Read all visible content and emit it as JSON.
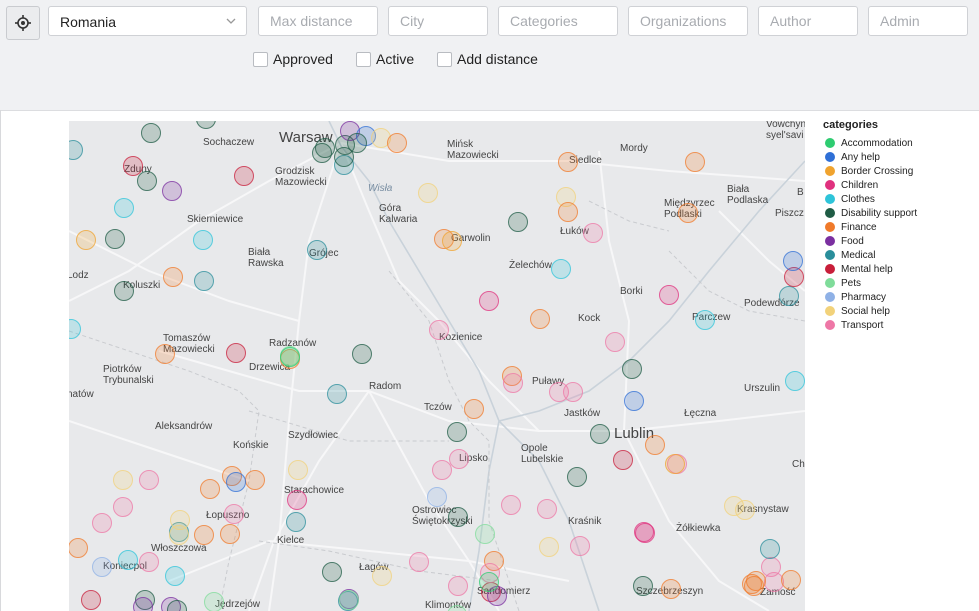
{
  "toolbar": {
    "locate_icon": "crosshair-icon",
    "country": "Romania",
    "max_distance_placeholder": "Max distance",
    "city_placeholder": "City",
    "categories_placeholder": "Categories",
    "organizations_placeholder": "Organizations",
    "author_placeholder": "Author",
    "admin_placeholder": "Admin",
    "checkboxes": [
      {
        "label": "Approved",
        "checked": false
      },
      {
        "label": "Active",
        "checked": false
      },
      {
        "label": "Add distance",
        "checked": false
      }
    ]
  },
  "legend": {
    "title": "categories",
    "items": [
      {
        "label": "Accommodation",
        "color": "#2ecc71"
      },
      {
        "label": "Any help",
        "color": "#2f6fd6"
      },
      {
        "label": "Border Crossing",
        "color": "#f0a32e"
      },
      {
        "label": "Children",
        "color": "#e0317e"
      },
      {
        "label": "Clothes",
        "color": "#2ec4d9"
      },
      {
        "label": "Disability support",
        "color": "#1f5c45"
      },
      {
        "label": "Finance",
        "color": "#f07a2a"
      },
      {
        "label": "Food",
        "color": "#7b2fa0"
      },
      {
        "label": "Medical",
        "color": "#2a8e9b"
      },
      {
        "label": "Mental help",
        "color": "#c81e3a"
      },
      {
        "label": "Pets",
        "color": "#7fdc9a"
      },
      {
        "label": "Pharmacy",
        "color": "#8fb1e6"
      },
      {
        "label": "Social help",
        "color": "#f2d27a"
      },
      {
        "label": "Transport",
        "color": "#ee77a6"
      }
    ]
  },
  "map": {
    "cities": [
      {
        "name": "Warsaw",
        "major": true
      },
      {
        "name": "Sochaczew"
      },
      {
        "name": "Mińsk Mazowiecki"
      },
      {
        "name": "Siedlce"
      },
      {
        "name": "Mordy"
      },
      {
        "name": "Zduny"
      },
      {
        "name": "Grodzisk Mazowiecki"
      },
      {
        "name": "Wisła",
        "water": true
      },
      {
        "name": "Biała Podlaska"
      },
      {
        "name": "Międzyrzec Podlaski"
      },
      {
        "name": "Piszcz"
      },
      {
        "name": "Skierniewice"
      },
      {
        "name": "Góra Kalwaria"
      },
      {
        "name": "Garwolin"
      },
      {
        "name": "Łuków"
      },
      {
        "name": "Biała Rawska"
      },
      {
        "name": "Grójec"
      },
      {
        "name": "Żelechów"
      },
      {
        "name": "Lodz"
      },
      {
        "name": "Koluszki"
      },
      {
        "name": "Borki"
      },
      {
        "name": "Parczew"
      },
      {
        "name": "Podewdórze"
      },
      {
        "name": "Kozienice"
      },
      {
        "name": "Kock"
      },
      {
        "name": "Tomaszów Mazowiecki"
      },
      {
        "name": "Radzanów"
      },
      {
        "name": "Piotrków Trybunalski"
      },
      {
        "name": "Drzewica"
      },
      {
        "name": "Radom"
      },
      {
        "name": "Puławy"
      },
      {
        "name": "Urszulin"
      },
      {
        "name": "natów"
      },
      {
        "name": "Tczów"
      },
      {
        "name": "Jastków"
      },
      {
        "name": "Łęczna"
      },
      {
        "name": "Aleksandrów"
      },
      {
        "name": "Szydłowiec"
      },
      {
        "name": "Lublin",
        "major": true
      },
      {
        "name": "Końskie"
      },
      {
        "name": "Opole Lubelskie"
      },
      {
        "name": "Lipsko"
      },
      {
        "name": "Ch"
      },
      {
        "name": "Starachowice"
      },
      {
        "name": "Ostrowiec Świętokrzyski"
      },
      {
        "name": "Łopuszno"
      },
      {
        "name": "Krasnystaw"
      },
      {
        "name": "Kraśnik"
      },
      {
        "name": "Żółkiewka"
      },
      {
        "name": "Kielce"
      },
      {
        "name": "Włoszczowa"
      },
      {
        "name": "Koniecpol"
      },
      {
        "name": "Łagów"
      },
      {
        "name": "Zamość"
      },
      {
        "name": "Sandomierz"
      },
      {
        "name": "Szczebrzeszyn"
      },
      {
        "name": "Jędrzejów"
      },
      {
        "name": "Klimontów"
      },
      {
        "name": "Vowchyn syel'savi"
      },
      {
        "name": "B"
      }
    ]
  }
}
